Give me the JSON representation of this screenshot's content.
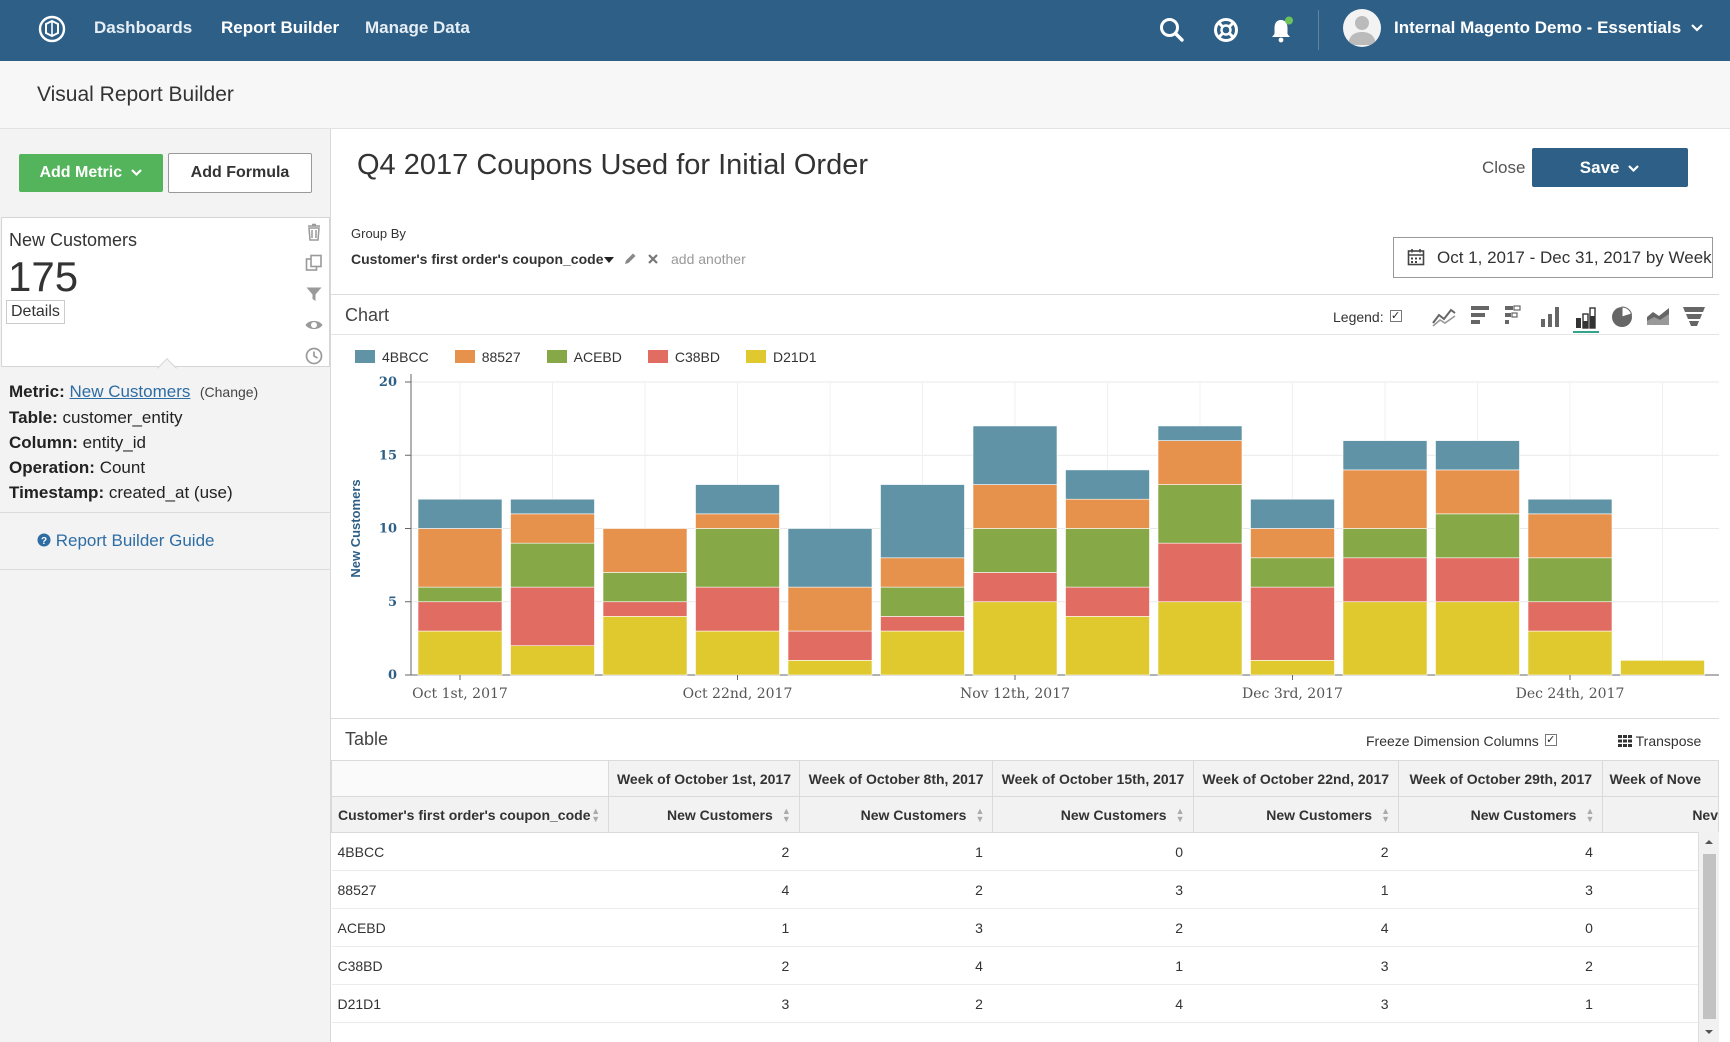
{
  "nav": {
    "links": [
      "Dashboards",
      "Report Builder",
      "Manage Data"
    ],
    "account": "Internal Magento Demo - Essentials"
  },
  "page": {
    "title": "Visual Report Builder"
  },
  "left": {
    "add_metric": "Add Metric",
    "add_formula": "Add Formula",
    "metric_name": "New Customers",
    "metric_value": "175",
    "details": "Details",
    "metric_label": "Metric:",
    "metric_link": "New Customers",
    "change": "(Change)",
    "table_label": "Table:",
    "table_value": "customer_entity",
    "column_label": "Column:",
    "column_value": "entity_id",
    "operation_label": "Operation:",
    "operation_value": "Count",
    "timestamp_label": "Timestamp:",
    "timestamp_value": "created_at (use)",
    "guide": "Report Builder Guide"
  },
  "report": {
    "title": "Q4 2017 Coupons Used for Initial Order",
    "close": "Close",
    "save": "Save",
    "group_by_label": "Group By",
    "group_by_value": "Customer's first order's coupon_code",
    "add_another": "add another",
    "date_range": "Oct 1, 2017 - Dec 31, 2017 by Week"
  },
  "chart_section": {
    "title": "Chart",
    "legend_label": "Legend:"
  },
  "chart_data": {
    "type": "bar",
    "stacked": true,
    "ylabel": "New Customers",
    "ylim": [
      0,
      20
    ],
    "yticks": [
      0,
      5,
      10,
      15,
      20
    ],
    "x_tick_labels": [
      {
        "index": 0,
        "label": "Oct 1st, 2017"
      },
      {
        "index": 3,
        "label": "Oct 22nd, 2017"
      },
      {
        "index": 6,
        "label": "Nov 12th, 2017"
      },
      {
        "index": 9,
        "label": "Dec 3rd, 2017"
      },
      {
        "index": 12,
        "label": "Dec 24th, 2017"
      }
    ],
    "categories": [
      "Oct 1, 2017",
      "Oct 8, 2017",
      "Oct 15, 2017",
      "Oct 22, 2017",
      "Oct 29, 2017",
      "Nov 5, 2017",
      "Nov 12, 2017",
      "Nov 19, 2017",
      "Nov 26, 2017",
      "Dec 3, 2017",
      "Dec 10, 2017",
      "Dec 17, 2017",
      "Dec 24, 2017",
      "Dec 31, 2017"
    ],
    "grid": true,
    "legend_position": "top-left",
    "series": [
      {
        "name": "D21D1",
        "color": "#dfc92f",
        "values": [
          3,
          2,
          4,
          3,
          1,
          3,
          5,
          4,
          5,
          1,
          5,
          5,
          3,
          1
        ]
      },
      {
        "name": "C38BD",
        "color": "#e16c61",
        "values": [
          2,
          4,
          1,
          3,
          2,
          1,
          2,
          2,
          4,
          5,
          3,
          3,
          2,
          0
        ]
      },
      {
        "name": "ACEBD",
        "color": "#86a846",
        "values": [
          1,
          3,
          2,
          4,
          0,
          2,
          3,
          4,
          4,
          2,
          2,
          3,
          3,
          0
        ]
      },
      {
        "name": "88527",
        "color": "#e6924c",
        "values": [
          4,
          2,
          3,
          1,
          3,
          2,
          3,
          2,
          3,
          2,
          4,
          3,
          3,
          0
        ]
      },
      {
        "name": "4BBCC",
        "color": "#5f93a5",
        "values": [
          2,
          1,
          0,
          2,
          4,
          5,
          4,
          2,
          1,
          2,
          2,
          2,
          1,
          0
        ]
      }
    ]
  },
  "table_section": {
    "title": "Table",
    "freeze": "Freeze Dimension Columns",
    "transpose": "Transpose",
    "dimension_header": "Customer's first order's coupon_code",
    "week_headers": [
      "Week of October 1st, 2017",
      "Week of October 8th, 2017",
      "Week of October 15th, 2017",
      "Week of October 22nd, 2017",
      "Week of October 29th, 2017",
      "Week of Nove"
    ],
    "sub_header": "New Customers",
    "sub_header_partial": "Nev",
    "rows": [
      {
        "code": "4BBCC",
        "values": [
          "2",
          "1",
          "0",
          "2",
          "4"
        ]
      },
      {
        "code": "88527",
        "values": [
          "4",
          "2",
          "3",
          "1",
          "3"
        ]
      },
      {
        "code": "ACEBD",
        "values": [
          "1",
          "3",
          "2",
          "4",
          "0"
        ]
      },
      {
        "code": "C38BD",
        "values": [
          "2",
          "4",
          "1",
          "3",
          "2"
        ]
      },
      {
        "code": "D21D1",
        "values": [
          "3",
          "2",
          "4",
          "3",
          "1"
        ]
      }
    ]
  },
  "colors": {
    "nav": "#2e5f86",
    "primary": "#2e5f86",
    "green": "#53b45b",
    "link": "#2e6da4"
  }
}
